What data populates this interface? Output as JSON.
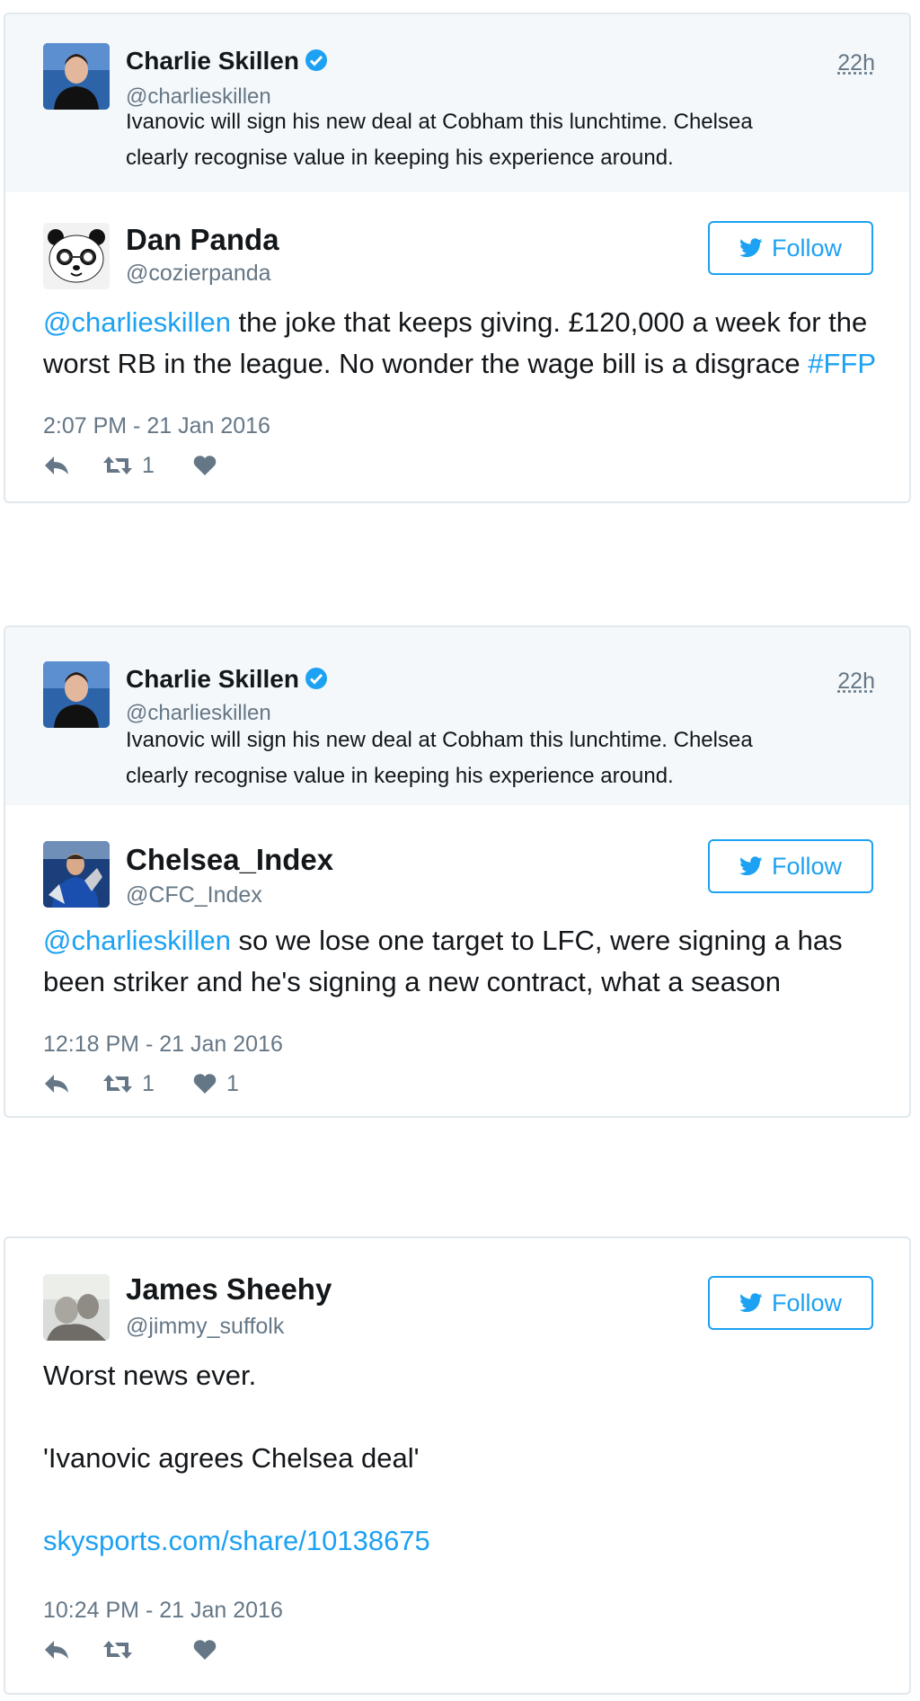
{
  "cards": [
    {
      "quoted": {
        "name": "Charlie Skillen",
        "handle": "@charlieskillen",
        "time": "22h",
        "text_line1": "Ivanovic will sign his new deal at Cobham this lunchtime. Chelsea",
        "text_line2": "clearly recognise value in keeping his experience around."
      },
      "name": "Dan Panda",
      "handle": "@cozierpanda",
      "follow_label": "Follow",
      "mention": "@charlieskillen",
      "text_main": " the joke that keeps giving. £120,000 a week for the worst RB in the league. No wonder the wage bill is a disgrace ",
      "hashtag": "#FFP",
      "date": "2:07 PM - 21 Jan 2016",
      "retweets": "1",
      "likes": ""
    },
    {
      "quoted": {
        "name": "Charlie Skillen",
        "handle": "@charlieskillen",
        "time": "22h",
        "text_line1": "Ivanovic will sign his new deal at Cobham this lunchtime. Chelsea",
        "text_line2": "clearly recognise value in keeping his experience around."
      },
      "name": "Chelsea_Index",
      "handle": "@CFC_Index",
      "follow_label": "Follow",
      "mention": "@charlieskillen",
      "text_main": " so we lose one target to LFC, were signing a has been striker and he's signing a new contract, what a season",
      "date": "12:18 PM - 21 Jan 2016",
      "retweets": "1",
      "likes": "1"
    },
    {
      "name": "James Sheehy",
      "handle": "@jimmy_suffolk",
      "follow_label": "Follow",
      "line1": "Worst news ever.",
      "line2": "'Ivanovic agrees Chelsea deal'",
      "link": "skysports.com/share/10138675",
      "date": "10:24 PM - 21 Jan 2016",
      "retweets": "",
      "likes": ""
    }
  ],
  "colors": {
    "accent": "#1da1f2",
    "muted": "#657786",
    "quoted_bg": "#f5f8fa",
    "border": "#e1e8ed"
  },
  "icons": [
    "verified-badge-icon",
    "twitter-bird-icon",
    "reply-icon",
    "retweet-icon",
    "like-icon"
  ]
}
